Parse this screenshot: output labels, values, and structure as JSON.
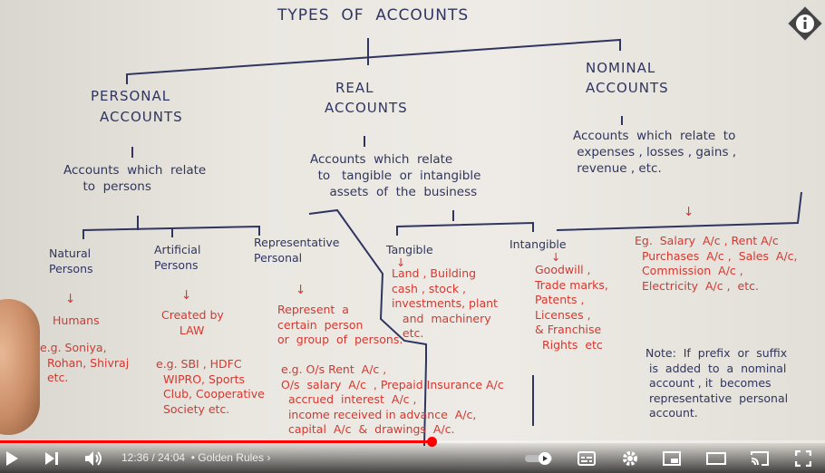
{
  "board": {
    "title": "TYPES  OF  ACCOUNTS",
    "personal": {
      "heading1": "PERSONAL",
      "heading2": "ACCOUNTS",
      "def": "Accounts  which  relate\n     to  persons",
      "natural": {
        "h": "Natural\nPersons",
        "arrow": "↓",
        "a": "Humans",
        "b": "e.g. Soniya,\n  Rohan, Shivraj\n  etc."
      },
      "artificial": {
        "h": "Artificial\nPersons",
        "arrow": "↓",
        "a": "Created by\n     LAW",
        "b": "e.g. SBI , HDFC\n  WIPRO, Sports\n  Club, Cooperative\n  Society etc."
      },
      "representative": {
        "h": "Representative\nPersonal",
        "arrow": "↓",
        "a": "Represent  a\ncertain  person\nor  group  of  persons.",
        "b": "e.g. O/s Rent  A/c ,\nO/s  salary  A/c  , Prepaid Insurance A/c\n  accrued  interest  A/c ,\n  income received in advance  A/c,\n  capital  A/c  &  drawings  A/c."
      }
    },
    "real": {
      "heading1": "REAL",
      "heading2": "ACCOUNTS",
      "def": "Accounts  which  relate\n  to   tangible  or  intangible\n     assets  of  the  business",
      "tangible": {
        "h": "Tangible",
        "arrow": "↓",
        "a": "Land , Building\ncash , stock ,\ninvestments, plant\n   and  machinery\n   etc."
      },
      "intangible": {
        "h": "Intangible",
        "arrow": "↓",
        "a": "Goodwill ,\nTrade marks,\nPatents ,\nLicenses ,\n& Franchise\n  Rights  etc"
      }
    },
    "nominal": {
      "heading1": "NOMINAL",
      "heading2": "ACCOUNTS",
      "def": "Accounts  which  relate  to\n expenses , losses , gains ,\n revenue , etc.",
      "arrow": "↓",
      "eg": "Eg.  Salary  A/c , Rent A/c\n  Purchases  A/c ,  Sales  A/c,\n  Commission  A/c ,\n  Electricity  A/c ,  etc.",
      "note": "Note:  If  prefix  or  suffix\n is  added  to  a  nominal\n account , it  becomes\n representative  personal\n account."
    }
  },
  "player": {
    "time": "12:36 / 24:04",
    "chapter": "• Golden Rules",
    "chapter_arrow": "›",
    "progress_fraction": 0.523,
    "accent": "#ff0000",
    "icons": [
      "play-icon",
      "next-icon",
      "volume-icon",
      "autoplay-toggle",
      "subtitles-icon",
      "settings-icon",
      "miniplayer-icon",
      "theater-icon",
      "cast-icon",
      "fullscreen-icon"
    ]
  },
  "info_icon": "info-icon"
}
